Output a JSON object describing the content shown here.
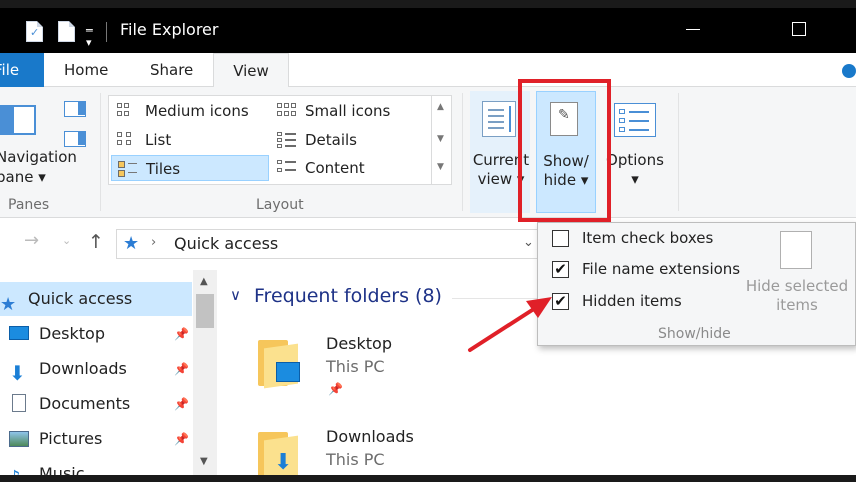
{
  "window": {
    "title": "File Explorer"
  },
  "tabs": {
    "file": "File",
    "home": "Home",
    "share": "Share",
    "view": "View"
  },
  "ribbon": {
    "panes": {
      "navigation_pane_label": "Navigation\npane ▾",
      "group_label": "Panes"
    },
    "layout": {
      "group_label": "Layout",
      "items": [
        "Medium icons",
        "Small icons",
        "List",
        "Details",
        "Tiles",
        "Content"
      ],
      "selected": "Tiles"
    },
    "current_view": {
      "label": "Current\nview ▾"
    },
    "show_hide": {
      "label": "Show/\nhide ▾"
    },
    "options": {
      "label": "Options\n▾"
    }
  },
  "address": {
    "location": "Quick access"
  },
  "nav_pane": {
    "items": [
      {
        "label": "Quick access",
        "icon": "star-icon",
        "pinned": false
      },
      {
        "label": "Desktop",
        "icon": "desktop-icon",
        "pinned": true
      },
      {
        "label": "Downloads",
        "icon": "downloads-icon",
        "pinned": true
      },
      {
        "label": "Documents",
        "icon": "documents-icon",
        "pinned": true
      },
      {
        "label": "Pictures",
        "icon": "pictures-icon",
        "pinned": true
      },
      {
        "label": "Music",
        "icon": "music-icon",
        "pinned": false
      }
    ]
  },
  "content": {
    "section_title": "Frequent folders (8)",
    "folders": [
      {
        "name": "Desktop",
        "location": "This PC"
      },
      {
        "name": "Downloads",
        "location": "This PC"
      }
    ]
  },
  "show_hide_panel": {
    "options": [
      {
        "label": "Item check boxes",
        "checked": false
      },
      {
        "label": "File name extensions",
        "checked": true
      },
      {
        "label": "Hidden items",
        "checked": true
      }
    ],
    "hide_selected_label": "Hide selected\nitems",
    "group_label": "Show/hide"
  },
  "colors": {
    "accent": "#1979ca",
    "annotation": "#e02028",
    "selection": "#cce8ff"
  }
}
